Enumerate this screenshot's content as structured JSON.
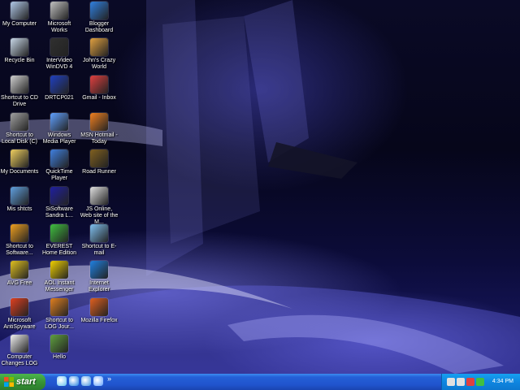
{
  "desktop_icons": [
    {
      "label": "My Computer",
      "icon": "my-computer-icon",
      "color": "#b0c8e8"
    },
    {
      "label": "Recycle Bin",
      "icon": "recycle-bin-icon",
      "color": "#c8d8e8"
    },
    {
      "label": "Shortcut to CD Drive",
      "icon": "cd-drive-icon",
      "color": "#d0d0d0"
    },
    {
      "label": "Shortcut to Local Disk (C)",
      "icon": "hard-disk-icon",
      "color": "#a0a0a0"
    },
    {
      "label": "My Documents",
      "icon": "my-documents-icon",
      "color": "#f0d060"
    },
    {
      "label": "Mis shtcts",
      "icon": "shortcuts-icon",
      "color": "#60a0e0"
    },
    {
      "label": "Shortcut to Software...",
      "icon": "software-icon",
      "color": "#f0a020"
    },
    {
      "label": "AVG Free",
      "icon": "avg-icon",
      "color": "#e0c020"
    },
    {
      "label": "Microsoft AntiSpyware",
      "icon": "antispyware-icon",
      "color": "#e04020"
    },
    {
      "label": "Computer Changes LOG",
      "icon": "document-icon",
      "color": "#f0f0f0"
    },
    {
      "label": "Microsoft Works",
      "icon": "works-icon",
      "color": "#c0c0c0"
    },
    {
      "label": "InterVideo WinDVD 4",
      "icon": "windvd-icon",
      "color": "#303030"
    },
    {
      "label": "DRTCP021",
      "icon": "drtcp-icon",
      "color": "#2040c0"
    },
    {
      "label": "Windows Media Player",
      "icon": "media-player-icon",
      "color": "#60a0ff"
    },
    {
      "label": "QuickTime Player",
      "icon": "quicktime-icon",
      "color": "#4080e0"
    },
    {
      "label": "SiSoftware Sandra L...",
      "icon": "sandra-icon",
      "color": "#2020a0"
    },
    {
      "label": "EVEREST Home Edition",
      "icon": "everest-icon",
      "color": "#40c040"
    },
    {
      "label": "AOL Instant Messenger",
      "icon": "aim-icon",
      "color": "#f0d000"
    },
    {
      "label": "Shortcut to LOG Jour...",
      "icon": "pen-icon",
      "color": "#e08020"
    },
    {
      "label": "Hello",
      "icon": "hello-icon",
      "color": "#60a040"
    },
    {
      "label": "Blogger Dashboard",
      "icon": "blogger-icon",
      "color": "#3080e0"
    },
    {
      "label": "John's Crazy World",
      "icon": "crazy-world-icon",
      "color": "#e0a040"
    },
    {
      "label": "Gmail - Inbox",
      "icon": "gmail-icon",
      "color": "#e04040"
    },
    {
      "label": "MSN Hotmail - Today",
      "icon": "msn-butterfly-icon",
      "color": "#f08020"
    },
    {
      "label": "Road Runner",
      "icon": "road-runner-icon",
      "color": "#806020"
    },
    {
      "label": "JS Online, Web site of the M...",
      "icon": "web-page-icon",
      "color": "#e0e0e0"
    },
    {
      "label": "Shortcut to E-mail",
      "icon": "email-icon",
      "color": "#80c0f0"
    },
    {
      "label": "Internet Explorer",
      "icon": "internet-explorer-icon",
      "color": "#2080e0"
    },
    {
      "label": "Mozilla Firefox",
      "icon": "firefox-icon",
      "color": "#e06020"
    }
  ],
  "taskbar": {
    "start_label": "start",
    "quick_launch": [
      {
        "icon": "show-desktop-icon",
        "color": "#60c0f0"
      },
      {
        "icon": "internet-explorer-icon",
        "color": "#2080e0"
      },
      {
        "icon": "outlook-express-icon",
        "color": "#4090e0"
      },
      {
        "icon": "media-player-icon",
        "color": "#60a0ff"
      }
    ],
    "chevron": "»",
    "tray_icons": [
      {
        "icon": "network-icon",
        "color": "#e0e0e0"
      },
      {
        "icon": "volume-icon",
        "color": "#e0e0e0"
      },
      {
        "icon": "antivirus-icon",
        "color": "#e04040"
      },
      {
        "icon": "messenger-icon",
        "color": "#40c040"
      }
    ],
    "clock": "4:34 PM"
  },
  "colors": {
    "taskbar_blue": "#2053cc",
    "start_green": "#379437",
    "tray_blue": "#0f86e0"
  }
}
